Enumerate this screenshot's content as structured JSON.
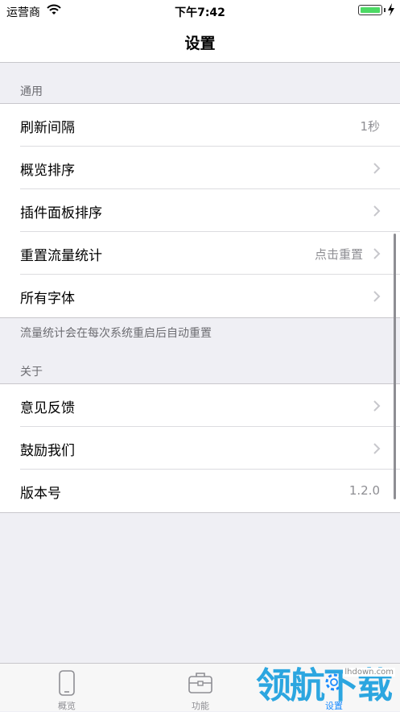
{
  "status_bar": {
    "carrier": "运营商",
    "time": "下午7:42",
    "battery_color": "#4cd964"
  },
  "nav": {
    "title": "设置"
  },
  "sections": {
    "general": {
      "header": "通用",
      "rows": [
        {
          "label": "刷新间隔",
          "value": "1秒"
        },
        {
          "label": "概览排序",
          "value": ""
        },
        {
          "label": "插件面板排序",
          "value": ""
        },
        {
          "label": "重置流量统计",
          "value": "点击重置"
        },
        {
          "label": "所有字体",
          "value": ""
        }
      ],
      "footer": "流量统计会在每次系统重启后自动重置"
    },
    "about": {
      "header": "关于",
      "rows": [
        {
          "label": "意见反馈",
          "value": ""
        },
        {
          "label": "鼓励我们",
          "value": ""
        },
        {
          "label": "版本号",
          "value": "1.2.0"
        }
      ]
    }
  },
  "tabbar": {
    "tabs": [
      {
        "label": "概览",
        "icon": "phone-icon",
        "active": false
      },
      {
        "label": "功能",
        "icon": "toolbox-icon",
        "active": false
      },
      {
        "label": "设置",
        "icon": "gear-icon",
        "active": true
      }
    ]
  },
  "watermark": {
    "text": "领航下载",
    "site": "lhdown.com",
    "color": "#2ca6e0"
  }
}
